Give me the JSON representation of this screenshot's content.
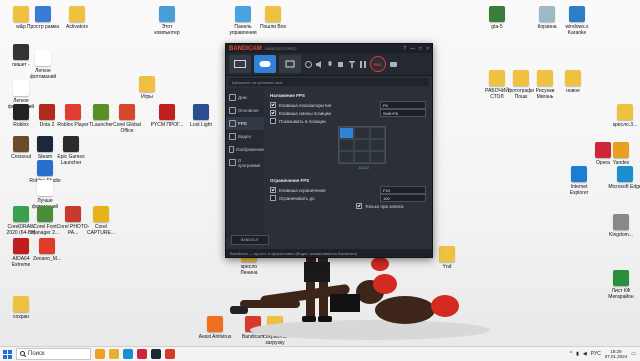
{
  "desktop": {
    "icons": [
      {
        "label": "w&p",
        "color": "#f0c040"
      },
      {
        "label": "Простр рамка",
        "color": "#3a7bd5"
      },
      {
        "label": "Activators",
        "color": "#f0c040"
      },
      {
        "label": "Этот компьютер",
        "color": "#4a9ed8"
      },
      {
        "label": "Панель управления",
        "color": "#4aa3df"
      },
      {
        "label": "Пошли Bos",
        "color": "#f0c040"
      },
      {
        "label": "gta-5",
        "color": "#3c7d3c"
      },
      {
        "label": "Корзина",
        "color": "#9fb8c8"
      },
      {
        "label": "windows.x Karaoke",
        "color": "#2c7fc4"
      },
      {
        "label": "пишет -",
        "color": "#333333"
      },
      {
        "label": "Легкое фотоманий",
        "color": "#ffffff"
      },
      {
        "label": "Легкое фотоманий",
        "color": "#ffffff"
      },
      {
        "label": "Игры",
        "color": "#f0c040"
      },
      {
        "label": "Roblox",
        "color": "#222222"
      },
      {
        "label": "Dota 2",
        "color": "#b02a1e"
      },
      {
        "label": "Roblox Player",
        "color": "#e03c31"
      },
      {
        "label": "TLauncher",
        "color": "#5a8f2a"
      },
      {
        "label": "Corel Global Office",
        "color": "#d6472e"
      },
      {
        "label": "PYCM ПРОГ...",
        "color": "#c02020"
      },
      {
        "label": "Lost Light",
        "color": "#2a4e8f"
      },
      {
        "label": "Crossout",
        "color": "#6b4b2a"
      },
      {
        "label": "Steam",
        "color": "#1b2838"
      },
      {
        "label": "Epic Games Launcher",
        "color": "#2b2b2b"
      },
      {
        "label": "Roblox Studio",
        "color": "#2a6ed0"
      },
      {
        "label": "Лучше фотоманий",
        "color": "#ffffff"
      },
      {
        "label": "CorelDRAW 2020 (64-Bit)",
        "color": "#3aa04a"
      },
      {
        "label": "Corel Font Manager 2...",
        "color": "#4a8e3a"
      },
      {
        "label": "Corel PHOTO-PA...",
        "color": "#c93a2e"
      },
      {
        "label": "Corel CAPTURE...",
        "color": "#e8b21a"
      },
      {
        "label": "AIDA64 Extreme",
        "color": "#c01e1e"
      },
      {
        "label": "Zenano_M...",
        "color": "#e03a2b"
      },
      {
        "label": "РАБОЧИЙ СТОЛ",
        "color": "#f0c040"
      },
      {
        "label": "фотографи Пошк",
        "color": "#f0c040"
      },
      {
        "label": "Рисунки Мигань",
        "color": "#f0c040"
      },
      {
        "label": "новое",
        "color": "#f0c040"
      },
      {
        "label": "кресло.3...",
        "color": "#f0c040"
      },
      {
        "label": "Opera",
        "color": "#d0243a"
      },
      {
        "label": "Yandex",
        "color": "#e8a020"
      },
      {
        "label": "Internet Explorer",
        "color": "#1c7dd6"
      },
      {
        "label": "Microsoft Edge",
        "color": "#1a8fd0"
      },
      {
        "label": "Kingdom...",
        "color": "#888888"
      },
      {
        "label": "Ynd",
        "color": "#f0c040"
      },
      {
        "label": "кресло Ленина",
        "color": "#f0c040"
      },
      {
        "label": "Лист КФ Мегарайон",
        "color": "#2a8f3a"
      },
      {
        "label": "сохран",
        "color": "#f0c040"
      },
      {
        "label": "Avast Antivirus",
        "color": "#f07020"
      },
      {
        "label": "Bandicam",
        "color": "#d63a2b"
      },
      {
        "label": "сохранять загрузку",
        "color": "#f0c040"
      }
    ]
  },
  "bandicam": {
    "brand": "BANDICAM",
    "version": "UNREGISTERED",
    "window_buttons": [
      "?",
      "—",
      "□",
      "×"
    ],
    "rec_label": "REC",
    "search_placeholder": "Щёлкните на целевом окне",
    "sidebar": [
      {
        "label": "Дом",
        "active": false
      },
      {
        "label": "Основное",
        "active": false
      },
      {
        "label": "FPS",
        "active": true
      },
      {
        "label": "Видео",
        "active": false
      },
      {
        "label": "Изображение",
        "active": false
      },
      {
        "label": "О программе",
        "active": false
      }
    ],
    "overlay_section": "Наложение FPS",
    "overlay_rows": [
      {
        "label": "Клавиша показа/скрытия",
        "value": "F6",
        "checked": true
      },
      {
        "label": "Клавиша смены позиции",
        "value": "Shift+F6",
        "checked": true
      },
      {
        "label": "Показывать в позиции",
        "value": "",
        "checked": false
      }
    ],
    "overlay_link": "ЗАКАЗ",
    "limit_section": "Ограничение FPS",
    "limit_rows": [
      {
        "label": "Клавиша ограничения",
        "value": "F10",
        "checked": true
      },
      {
        "label": "Ограничивать до",
        "value": "100",
        "checked": false
      }
    ],
    "limit_only_rec": "Только при записи",
    "banner": "BANDICUT",
    "footer": "Bandicam — просто и эффективно (Видео захватывается Bandicam)"
  },
  "taskbar": {
    "search_placeholder": "Поиск",
    "lang": "РУС",
    "time": "18:29",
    "date": "07.01.2024"
  }
}
